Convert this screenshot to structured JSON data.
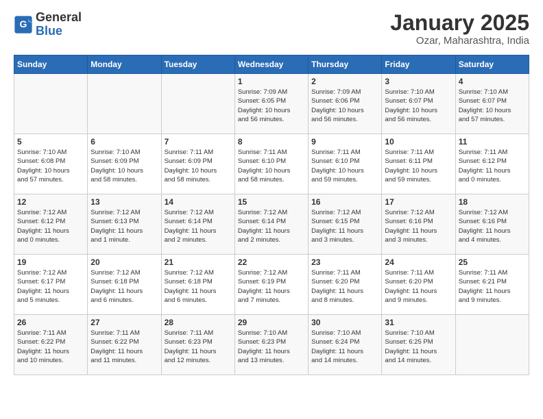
{
  "header": {
    "logo_line1": "General",
    "logo_line2": "Blue",
    "title": "January 2025",
    "subtitle": "Ozar, Maharashtra, India"
  },
  "days_of_week": [
    "Sunday",
    "Monday",
    "Tuesday",
    "Wednesday",
    "Thursday",
    "Friday",
    "Saturday"
  ],
  "weeks": [
    [
      {
        "day": "",
        "info": ""
      },
      {
        "day": "",
        "info": ""
      },
      {
        "day": "",
        "info": ""
      },
      {
        "day": "1",
        "info": "Sunrise: 7:09 AM\nSunset: 6:05 PM\nDaylight: 10 hours\nand 56 minutes."
      },
      {
        "day": "2",
        "info": "Sunrise: 7:09 AM\nSunset: 6:06 PM\nDaylight: 10 hours\nand 56 minutes."
      },
      {
        "day": "3",
        "info": "Sunrise: 7:10 AM\nSunset: 6:07 PM\nDaylight: 10 hours\nand 56 minutes."
      },
      {
        "day": "4",
        "info": "Sunrise: 7:10 AM\nSunset: 6:07 PM\nDaylight: 10 hours\nand 57 minutes."
      }
    ],
    [
      {
        "day": "5",
        "info": "Sunrise: 7:10 AM\nSunset: 6:08 PM\nDaylight: 10 hours\nand 57 minutes."
      },
      {
        "day": "6",
        "info": "Sunrise: 7:10 AM\nSunset: 6:09 PM\nDaylight: 10 hours\nand 58 minutes."
      },
      {
        "day": "7",
        "info": "Sunrise: 7:11 AM\nSunset: 6:09 PM\nDaylight: 10 hours\nand 58 minutes."
      },
      {
        "day": "8",
        "info": "Sunrise: 7:11 AM\nSunset: 6:10 PM\nDaylight: 10 hours\nand 58 minutes."
      },
      {
        "day": "9",
        "info": "Sunrise: 7:11 AM\nSunset: 6:10 PM\nDaylight: 10 hours\nand 59 minutes."
      },
      {
        "day": "10",
        "info": "Sunrise: 7:11 AM\nSunset: 6:11 PM\nDaylight: 10 hours\nand 59 minutes."
      },
      {
        "day": "11",
        "info": "Sunrise: 7:11 AM\nSunset: 6:12 PM\nDaylight: 11 hours\nand 0 minutes."
      }
    ],
    [
      {
        "day": "12",
        "info": "Sunrise: 7:12 AM\nSunset: 6:12 PM\nDaylight: 11 hours\nand 0 minutes."
      },
      {
        "day": "13",
        "info": "Sunrise: 7:12 AM\nSunset: 6:13 PM\nDaylight: 11 hours\nand 1 minute."
      },
      {
        "day": "14",
        "info": "Sunrise: 7:12 AM\nSunset: 6:14 PM\nDaylight: 11 hours\nand 2 minutes."
      },
      {
        "day": "15",
        "info": "Sunrise: 7:12 AM\nSunset: 6:14 PM\nDaylight: 11 hours\nand 2 minutes."
      },
      {
        "day": "16",
        "info": "Sunrise: 7:12 AM\nSunset: 6:15 PM\nDaylight: 11 hours\nand 3 minutes."
      },
      {
        "day": "17",
        "info": "Sunrise: 7:12 AM\nSunset: 6:16 PM\nDaylight: 11 hours\nand 3 minutes."
      },
      {
        "day": "18",
        "info": "Sunrise: 7:12 AM\nSunset: 6:16 PM\nDaylight: 11 hours\nand 4 minutes."
      }
    ],
    [
      {
        "day": "19",
        "info": "Sunrise: 7:12 AM\nSunset: 6:17 PM\nDaylight: 11 hours\nand 5 minutes."
      },
      {
        "day": "20",
        "info": "Sunrise: 7:12 AM\nSunset: 6:18 PM\nDaylight: 11 hours\nand 6 minutes."
      },
      {
        "day": "21",
        "info": "Sunrise: 7:12 AM\nSunset: 6:18 PM\nDaylight: 11 hours\nand 6 minutes."
      },
      {
        "day": "22",
        "info": "Sunrise: 7:12 AM\nSunset: 6:19 PM\nDaylight: 11 hours\nand 7 minutes."
      },
      {
        "day": "23",
        "info": "Sunrise: 7:11 AM\nSunset: 6:20 PM\nDaylight: 11 hours\nand 8 minutes."
      },
      {
        "day": "24",
        "info": "Sunrise: 7:11 AM\nSunset: 6:20 PM\nDaylight: 11 hours\nand 9 minutes."
      },
      {
        "day": "25",
        "info": "Sunrise: 7:11 AM\nSunset: 6:21 PM\nDaylight: 11 hours\nand 9 minutes."
      }
    ],
    [
      {
        "day": "26",
        "info": "Sunrise: 7:11 AM\nSunset: 6:22 PM\nDaylight: 11 hours\nand 10 minutes."
      },
      {
        "day": "27",
        "info": "Sunrise: 7:11 AM\nSunset: 6:22 PM\nDaylight: 11 hours\nand 11 minutes."
      },
      {
        "day": "28",
        "info": "Sunrise: 7:11 AM\nSunset: 6:23 PM\nDaylight: 11 hours\nand 12 minutes."
      },
      {
        "day": "29",
        "info": "Sunrise: 7:10 AM\nSunset: 6:23 PM\nDaylight: 11 hours\nand 13 minutes."
      },
      {
        "day": "30",
        "info": "Sunrise: 7:10 AM\nSunset: 6:24 PM\nDaylight: 11 hours\nand 14 minutes."
      },
      {
        "day": "31",
        "info": "Sunrise: 7:10 AM\nSunset: 6:25 PM\nDaylight: 11 hours\nand 14 minutes."
      },
      {
        "day": "",
        "info": ""
      }
    ]
  ]
}
